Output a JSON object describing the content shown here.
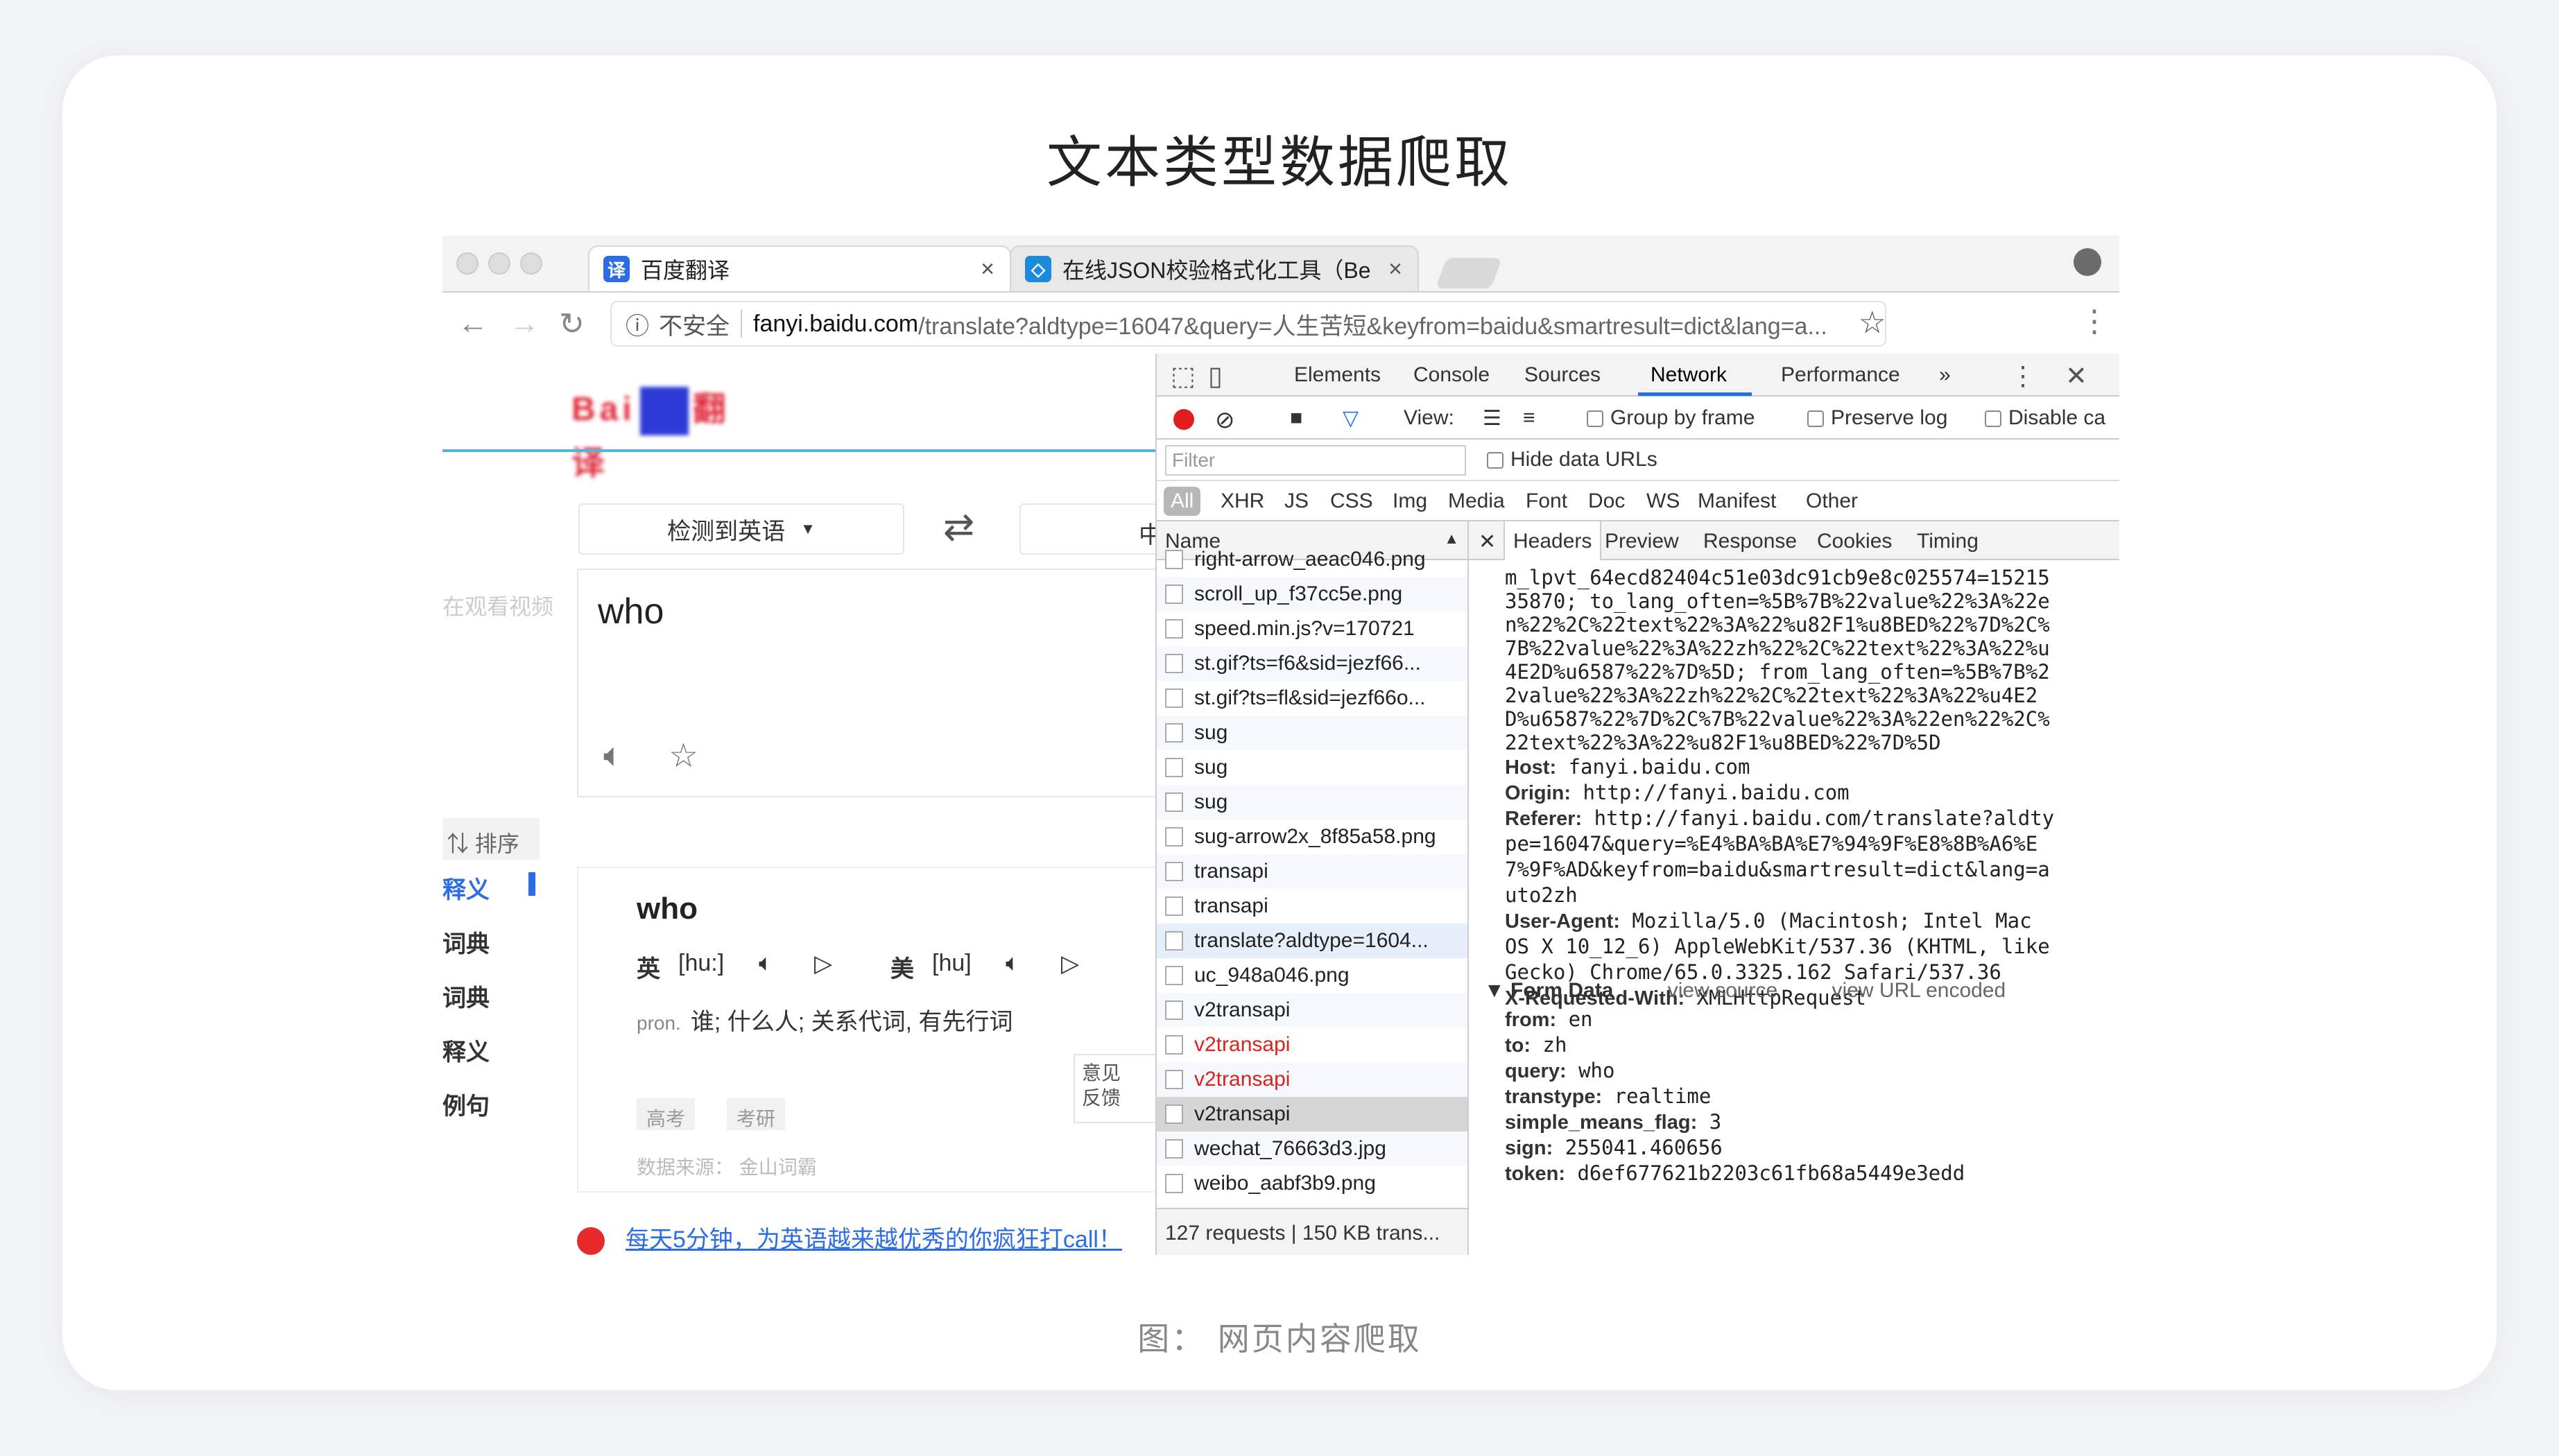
{
  "slide": {
    "title": "文本类型数据爬取",
    "caption": "图： 网页内容爬取"
  },
  "browser": {
    "tabs": [
      {
        "label": "百度翻译",
        "icon": "译"
      },
      {
        "label": "在线JSON校验格式化工具（Be",
        "icon": "◇"
      }
    ],
    "url": {
      "security": "不安全",
      "host": "fanyi.baidu.com",
      "path": "/translate?aldtype=16047&query=人生苦短&keyfrom=baidu&smartresult=dict&lang=a..."
    }
  },
  "baidu": {
    "source_lang": "检测到英语",
    "target_lang": "中",
    "video_hint": "在观看视频",
    "input_word": "who",
    "sort_label": "排序",
    "sidebar": [
      "释义",
      "词典",
      "词典",
      "释义",
      "例句"
    ],
    "result": {
      "word": "who",
      "uk_label": "英",
      "uk_phon": "[hu:]",
      "us_label": "美",
      "us_phon": "[hu]",
      "pron": "pron.",
      "defs": "谁; 什么人; 关系代词, 有先行词",
      "tags": [
        "高考",
        "考研"
      ],
      "source": "数据来源： 金山词霸"
    },
    "feedback": "意见\n反馈",
    "promo": "每天5分钟，为英语越来越优秀的你疯狂打call！"
  },
  "devtools": {
    "tabs": [
      "Elements",
      "Console",
      "Sources",
      "Network",
      "Performance",
      "»"
    ],
    "view_label": "View:",
    "group_by_frame": "Group by frame",
    "preserve_log": "Preserve log",
    "disable_cache": "Disable ca",
    "filter_placeholder": "Filter",
    "hide_data_urls": "Hide data URLs",
    "types": [
      "All",
      "XHR",
      "JS",
      "CSS",
      "Img",
      "Media",
      "Font",
      "Doc",
      "WS",
      "Manifest",
      "Other"
    ],
    "name_header": "Name",
    "requests": [
      {
        "name": "right-arrow_aeac046.png",
        "style": ""
      },
      {
        "name": "scroll_up_f37cc5e.png",
        "style": ""
      },
      {
        "name": "speed.min.js?v=170721",
        "style": ""
      },
      {
        "name": "st.gif?ts=f6&sid=jezf66...",
        "style": ""
      },
      {
        "name": "st.gif?ts=fl&sid=jezf66o...",
        "style": ""
      },
      {
        "name": "sug",
        "style": ""
      },
      {
        "name": "sug",
        "style": ""
      },
      {
        "name": "sug",
        "style": ""
      },
      {
        "name": "sug-arrow2x_8f85a58.png",
        "style": ""
      },
      {
        "name": "transapi",
        "style": ""
      },
      {
        "name": "transapi",
        "style": ""
      },
      {
        "name": "translate?aldtype=1604...",
        "style": "hl"
      },
      {
        "name": "uc_948a046.png",
        "style": ""
      },
      {
        "name": "v2transapi",
        "style": ""
      },
      {
        "name": "v2transapi",
        "style": "red"
      },
      {
        "name": "v2transapi",
        "style": "red"
      },
      {
        "name": "v2transapi",
        "style": "sel"
      },
      {
        "name": "wechat_76663d3.jpg",
        "style": ""
      },
      {
        "name": "weibo_aabf3b9.png",
        "style": ""
      }
    ],
    "summary": "127 requests | 150 KB trans...",
    "detail_tabs": [
      "Headers",
      "Preview",
      "Response",
      "Cookies",
      "Timing"
    ],
    "cookie_text": "m_lpvt_64ecd82404c51e03dc91cb9e8c025574=15215\n35870; to_lang_often=%5B%7B%22value%22%3A%22e\nn%22%2C%22text%22%3A%22%u82F1%u8BED%22%7D%2C%\n7B%22value%22%3A%22zh%22%2C%22text%22%3A%22%u\n4E2D%u6587%22%7D%5D; from_lang_often=%5B%7B%2\n2value%22%3A%22zh%22%2C%22text%22%3A%22%u4E2\nD%u6587%22%7D%2C%7B%22value%22%3A%22en%22%2C%\n22text%22%3A%22%u82F1%u8BED%22%7D%5D",
    "headers": [
      {
        "k": "Host:",
        "v": " fanyi.baidu.com"
      },
      {
        "k": "Origin:",
        "v": " http://fanyi.baidu.com"
      },
      {
        "k": "Referer:",
        "v": " http://fanyi.baidu.com/translate?aldty\npe=16047&query=%E4%BA%BA%E7%94%9F%E8%8B%A6%E\n7%9F%AD&keyfrom=baidu&smartresult=dict&lang=a\nuto2zh"
      },
      {
        "k": "User-Agent:",
        "v": " Mozilla/5.0 (Macintosh; Intel Mac\nOS X 10_12_6) AppleWebKit/537.36 (KHTML, like\nGecko) Chrome/65.0.3325.162 Safari/537.36"
      },
      {
        "k": "X-Requested-With:",
        "v": " XMLHttpRequest"
      }
    ],
    "form": {
      "title": "Form Data",
      "view_source": "view source",
      "view_url": "view URL encoded",
      "fields": [
        {
          "k": "from:",
          "v": " en"
        },
        {
          "k": "to:",
          "v": " zh"
        },
        {
          "k": "query:",
          "v": " who"
        },
        {
          "k": "transtype:",
          "v": " realtime"
        },
        {
          "k": "simple_means_flag:",
          "v": " 3"
        },
        {
          "k": "sign:",
          "v": " 255041.460656"
        },
        {
          "k": "token:",
          "v": " d6ef677621b2203c61fb68a5449e3edd"
        }
      ]
    }
  }
}
